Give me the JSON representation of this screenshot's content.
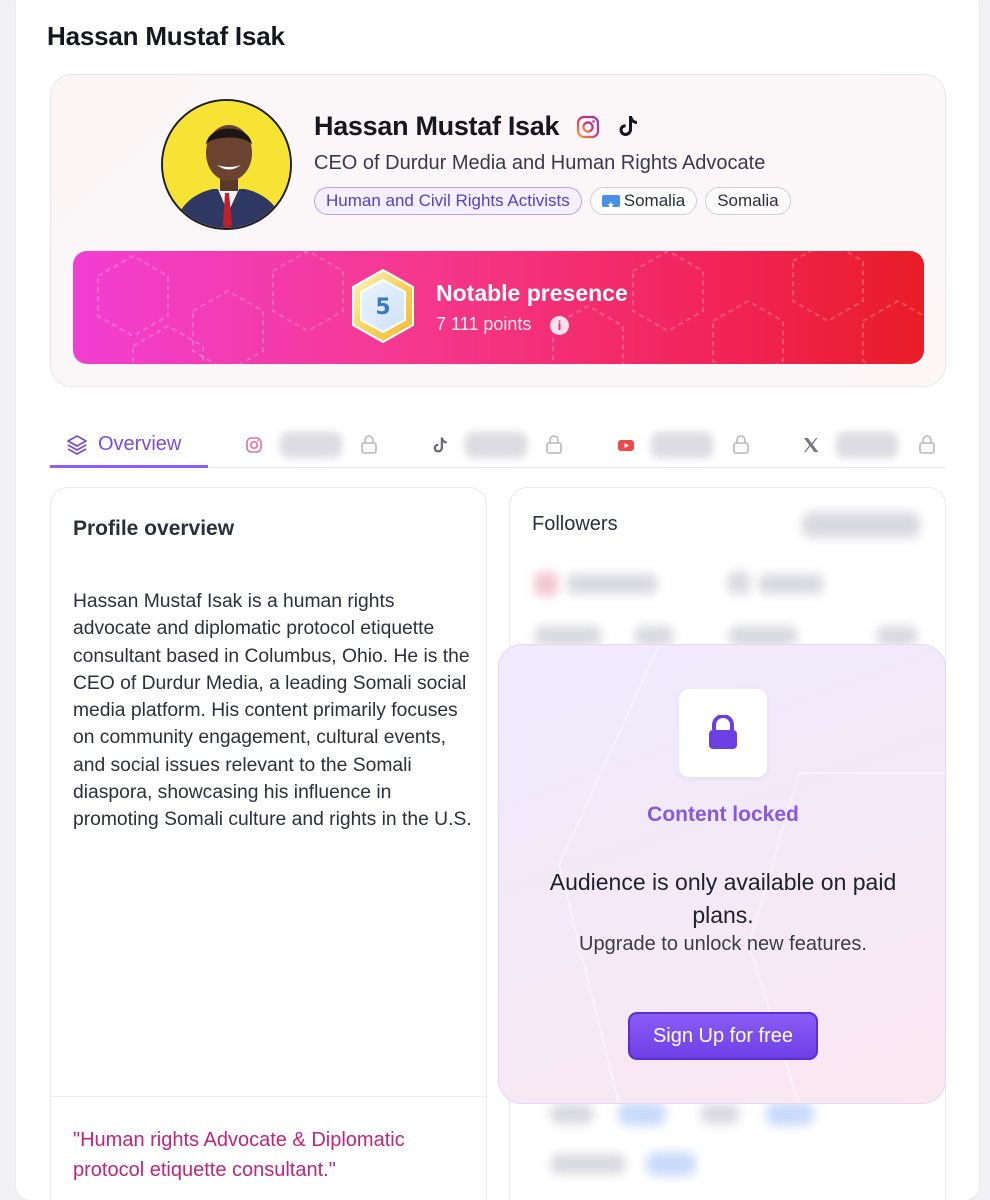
{
  "page": {
    "title": "Hassan Mustaf Isak"
  },
  "profile": {
    "name": "Hassan Mustaf Isak",
    "subtitle": "CEO of Durdur Media and Human Rights Advocate",
    "tags": [
      "Human and Civil Rights Activists",
      "Somalia",
      "Somalia"
    ],
    "social_icons": [
      "instagram-icon",
      "tiktok-icon"
    ]
  },
  "banner": {
    "level": "5",
    "title": "Notable presence",
    "points": "7 111 points",
    "info_glyph": "i",
    "colors": {
      "start": "#f23fd3",
      "end": "#e81d26"
    }
  },
  "tabs": {
    "active_label": "Overview",
    "locked_tabs": [
      "instagram",
      "tiktok",
      "youtube",
      "x"
    ]
  },
  "overview": {
    "title": "Profile overview",
    "text": "Hassan Mustaf Isak is a human rights advocate and diplomatic protocol etiquette consultant based in Columbus, Ohio. He is the CEO of Durdur Media, a leading Somali social media platform. His content primarily focuses on community engagement, cultural events, and social issues relevant to the Somali diaspora, showcasing his influence in promoting Somali culture and rights in the U.S.",
    "quote": "\"Human rights Advocate & Diplomatic protocol etiquette consultant.\""
  },
  "followers": {
    "title": "Followers"
  },
  "locked": {
    "title": "Content locked",
    "message": "Audience is only available on paid plans.",
    "sub": "Upgrade to unlock new features.",
    "button": "Sign Up for free",
    "accent": "#8b5cf6"
  }
}
